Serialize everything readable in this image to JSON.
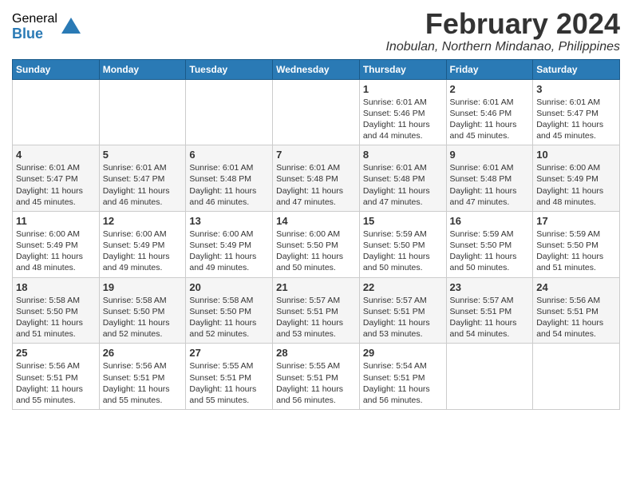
{
  "logo": {
    "general": "General",
    "blue": "Blue"
  },
  "title": {
    "month_year": "February 2024",
    "location": "Inobulan, Northern Mindanao, Philippines"
  },
  "headers": [
    "Sunday",
    "Monday",
    "Tuesday",
    "Wednesday",
    "Thursday",
    "Friday",
    "Saturday"
  ],
  "weeks": [
    [
      {
        "day": "",
        "info": ""
      },
      {
        "day": "",
        "info": ""
      },
      {
        "day": "",
        "info": ""
      },
      {
        "day": "",
        "info": ""
      },
      {
        "day": "1",
        "info": "Sunrise: 6:01 AM\nSunset: 5:46 PM\nDaylight: 11 hours\nand 44 minutes."
      },
      {
        "day": "2",
        "info": "Sunrise: 6:01 AM\nSunset: 5:46 PM\nDaylight: 11 hours\nand 45 minutes."
      },
      {
        "day": "3",
        "info": "Sunrise: 6:01 AM\nSunset: 5:47 PM\nDaylight: 11 hours\nand 45 minutes."
      }
    ],
    [
      {
        "day": "4",
        "info": "Sunrise: 6:01 AM\nSunset: 5:47 PM\nDaylight: 11 hours\nand 45 minutes."
      },
      {
        "day": "5",
        "info": "Sunrise: 6:01 AM\nSunset: 5:47 PM\nDaylight: 11 hours\nand 46 minutes."
      },
      {
        "day": "6",
        "info": "Sunrise: 6:01 AM\nSunset: 5:48 PM\nDaylight: 11 hours\nand 46 minutes."
      },
      {
        "day": "7",
        "info": "Sunrise: 6:01 AM\nSunset: 5:48 PM\nDaylight: 11 hours\nand 47 minutes."
      },
      {
        "day": "8",
        "info": "Sunrise: 6:01 AM\nSunset: 5:48 PM\nDaylight: 11 hours\nand 47 minutes."
      },
      {
        "day": "9",
        "info": "Sunrise: 6:01 AM\nSunset: 5:48 PM\nDaylight: 11 hours\nand 47 minutes."
      },
      {
        "day": "10",
        "info": "Sunrise: 6:00 AM\nSunset: 5:49 PM\nDaylight: 11 hours\nand 48 minutes."
      }
    ],
    [
      {
        "day": "11",
        "info": "Sunrise: 6:00 AM\nSunset: 5:49 PM\nDaylight: 11 hours\nand 48 minutes."
      },
      {
        "day": "12",
        "info": "Sunrise: 6:00 AM\nSunset: 5:49 PM\nDaylight: 11 hours\nand 49 minutes."
      },
      {
        "day": "13",
        "info": "Sunrise: 6:00 AM\nSunset: 5:49 PM\nDaylight: 11 hours\nand 49 minutes."
      },
      {
        "day": "14",
        "info": "Sunrise: 6:00 AM\nSunset: 5:50 PM\nDaylight: 11 hours\nand 50 minutes."
      },
      {
        "day": "15",
        "info": "Sunrise: 5:59 AM\nSunset: 5:50 PM\nDaylight: 11 hours\nand 50 minutes."
      },
      {
        "day": "16",
        "info": "Sunrise: 5:59 AM\nSunset: 5:50 PM\nDaylight: 11 hours\nand 50 minutes."
      },
      {
        "day": "17",
        "info": "Sunrise: 5:59 AM\nSunset: 5:50 PM\nDaylight: 11 hours\nand 51 minutes."
      }
    ],
    [
      {
        "day": "18",
        "info": "Sunrise: 5:58 AM\nSunset: 5:50 PM\nDaylight: 11 hours\nand 51 minutes."
      },
      {
        "day": "19",
        "info": "Sunrise: 5:58 AM\nSunset: 5:50 PM\nDaylight: 11 hours\nand 52 minutes."
      },
      {
        "day": "20",
        "info": "Sunrise: 5:58 AM\nSunset: 5:50 PM\nDaylight: 11 hours\nand 52 minutes."
      },
      {
        "day": "21",
        "info": "Sunrise: 5:57 AM\nSunset: 5:51 PM\nDaylight: 11 hours\nand 53 minutes."
      },
      {
        "day": "22",
        "info": "Sunrise: 5:57 AM\nSunset: 5:51 PM\nDaylight: 11 hours\nand 53 minutes."
      },
      {
        "day": "23",
        "info": "Sunrise: 5:57 AM\nSunset: 5:51 PM\nDaylight: 11 hours\nand 54 minutes."
      },
      {
        "day": "24",
        "info": "Sunrise: 5:56 AM\nSunset: 5:51 PM\nDaylight: 11 hours\nand 54 minutes."
      }
    ],
    [
      {
        "day": "25",
        "info": "Sunrise: 5:56 AM\nSunset: 5:51 PM\nDaylight: 11 hours\nand 55 minutes."
      },
      {
        "day": "26",
        "info": "Sunrise: 5:56 AM\nSunset: 5:51 PM\nDaylight: 11 hours\nand 55 minutes."
      },
      {
        "day": "27",
        "info": "Sunrise: 5:55 AM\nSunset: 5:51 PM\nDaylight: 11 hours\nand 55 minutes."
      },
      {
        "day": "28",
        "info": "Sunrise: 5:55 AM\nSunset: 5:51 PM\nDaylight: 11 hours\nand 56 minutes."
      },
      {
        "day": "29",
        "info": "Sunrise: 5:54 AM\nSunset: 5:51 PM\nDaylight: 11 hours\nand 56 minutes."
      },
      {
        "day": "",
        "info": ""
      },
      {
        "day": "",
        "info": ""
      }
    ]
  ]
}
